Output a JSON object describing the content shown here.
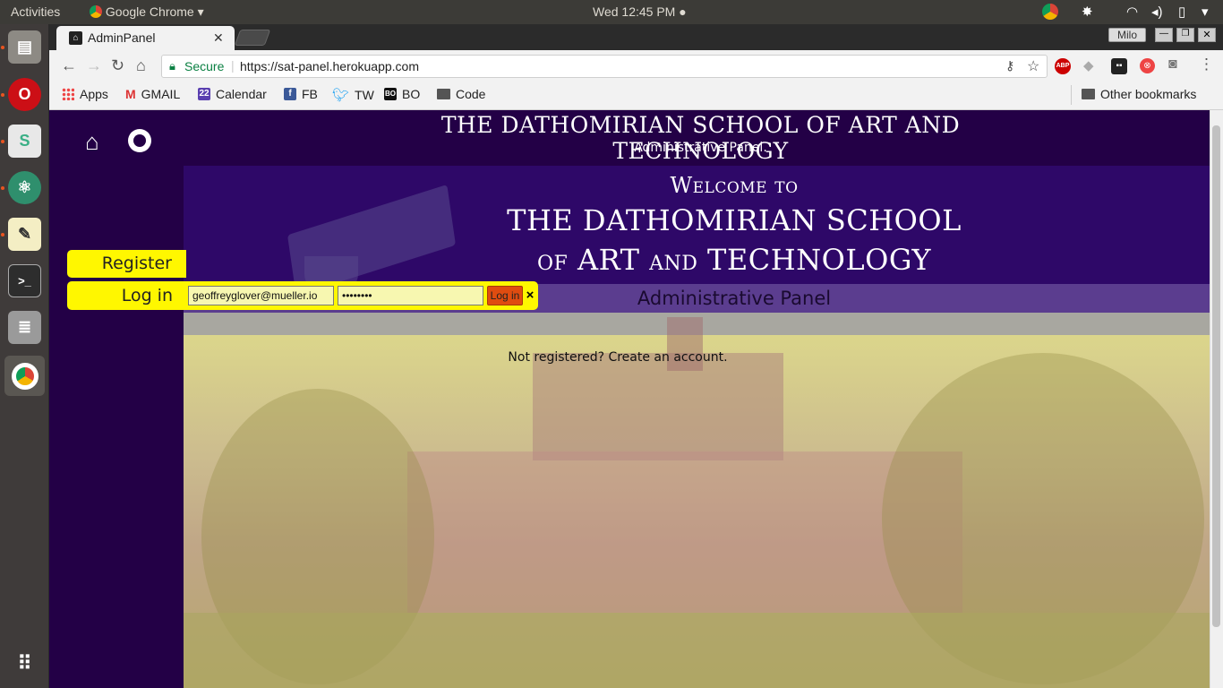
{
  "system": {
    "activities": "Activities",
    "app_name": "Google Chrome",
    "clock": "Wed 12:45 PM"
  },
  "browser": {
    "tab_title": "AdminPanel",
    "user": "Milo",
    "secure_label": "Secure",
    "url": "https://sat-panel.herokuapp.com",
    "bookmarks": [
      {
        "label": "Apps"
      },
      {
        "label": "GMAIL"
      },
      {
        "label": "Calendar",
        "badge": "22"
      },
      {
        "label": "FB"
      },
      {
        "label": "TW"
      },
      {
        "label": "BO"
      },
      {
        "label": "Code"
      }
    ],
    "other_bookmarks": "Other bookmarks"
  },
  "page": {
    "header_title": "THE DATHOMIRIAN SCHOOL OF ART AND TECHNOLOGY",
    "header_subtitle": "Administrative Panel.",
    "welcome": "Welcome to",
    "school_line1": "THE DATHOMIRIAN SCHOOL",
    "school_line2": "of ART and TECHNOLOGY",
    "admin_bar": "Administrative Panel",
    "register_tab": "Register",
    "login_tab": "Log in",
    "email_value": "geoffreyglover@mueller.io",
    "password_value": "••••••••",
    "login_button": "Log in",
    "close_symbol": "×",
    "not_registered": "Not registered? Create an account."
  },
  "colors": {
    "page_bg": "#230046",
    "banner": "#2e0868",
    "admin_bar": "#5b3d8f",
    "tab_yellow": "#fff700",
    "login_button": "#e04c10"
  }
}
